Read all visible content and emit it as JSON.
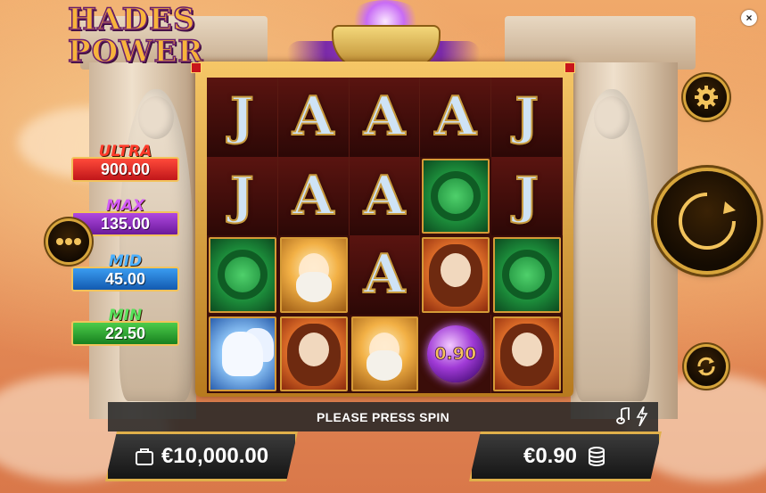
{
  "game": {
    "logo_line1": "HADES",
    "logo_line2": "POWER"
  },
  "colors": {
    "accent_gold": "#e0b04a",
    "ultra": "#e02a2a",
    "max": "#8b2bc2",
    "mid": "#1d7ad8",
    "min": "#2aa43a"
  },
  "jackpots": [
    {
      "label": "ULTRA",
      "value": "900.00"
    },
    {
      "label": "MAX",
      "value": "135.00"
    },
    {
      "label": "MID",
      "value": "45.00"
    },
    {
      "label": "MIN",
      "value": "22.50"
    }
  ],
  "reels": [
    [
      "J",
      "J",
      "snake",
      "pegasus"
    ],
    [
      "A",
      "A",
      "zeus",
      "goddess"
    ],
    [
      "A",
      "A",
      "A",
      "zeus"
    ],
    [
      "A",
      "snake",
      "goddess",
      "orb"
    ],
    [
      "J",
      "J",
      "snake",
      "goddess"
    ]
  ],
  "orb_value": "0.90",
  "status": {
    "message": "PLEASE PRESS SPIN"
  },
  "balance": {
    "amount": "€10,000.00",
    "icon": "wallet-icon"
  },
  "bet": {
    "amount": "€0.90",
    "icon": "coins-icon"
  },
  "controls": {
    "menu_icon": "dots-menu-icon",
    "settings_icon": "gear-icon",
    "spin_icon": "spin-arrow-icon",
    "autoplay_icon": "autoplay-icon",
    "sound_icon": "music-note-icon",
    "turbo_icon": "lightning-icon",
    "close_label": "×"
  }
}
